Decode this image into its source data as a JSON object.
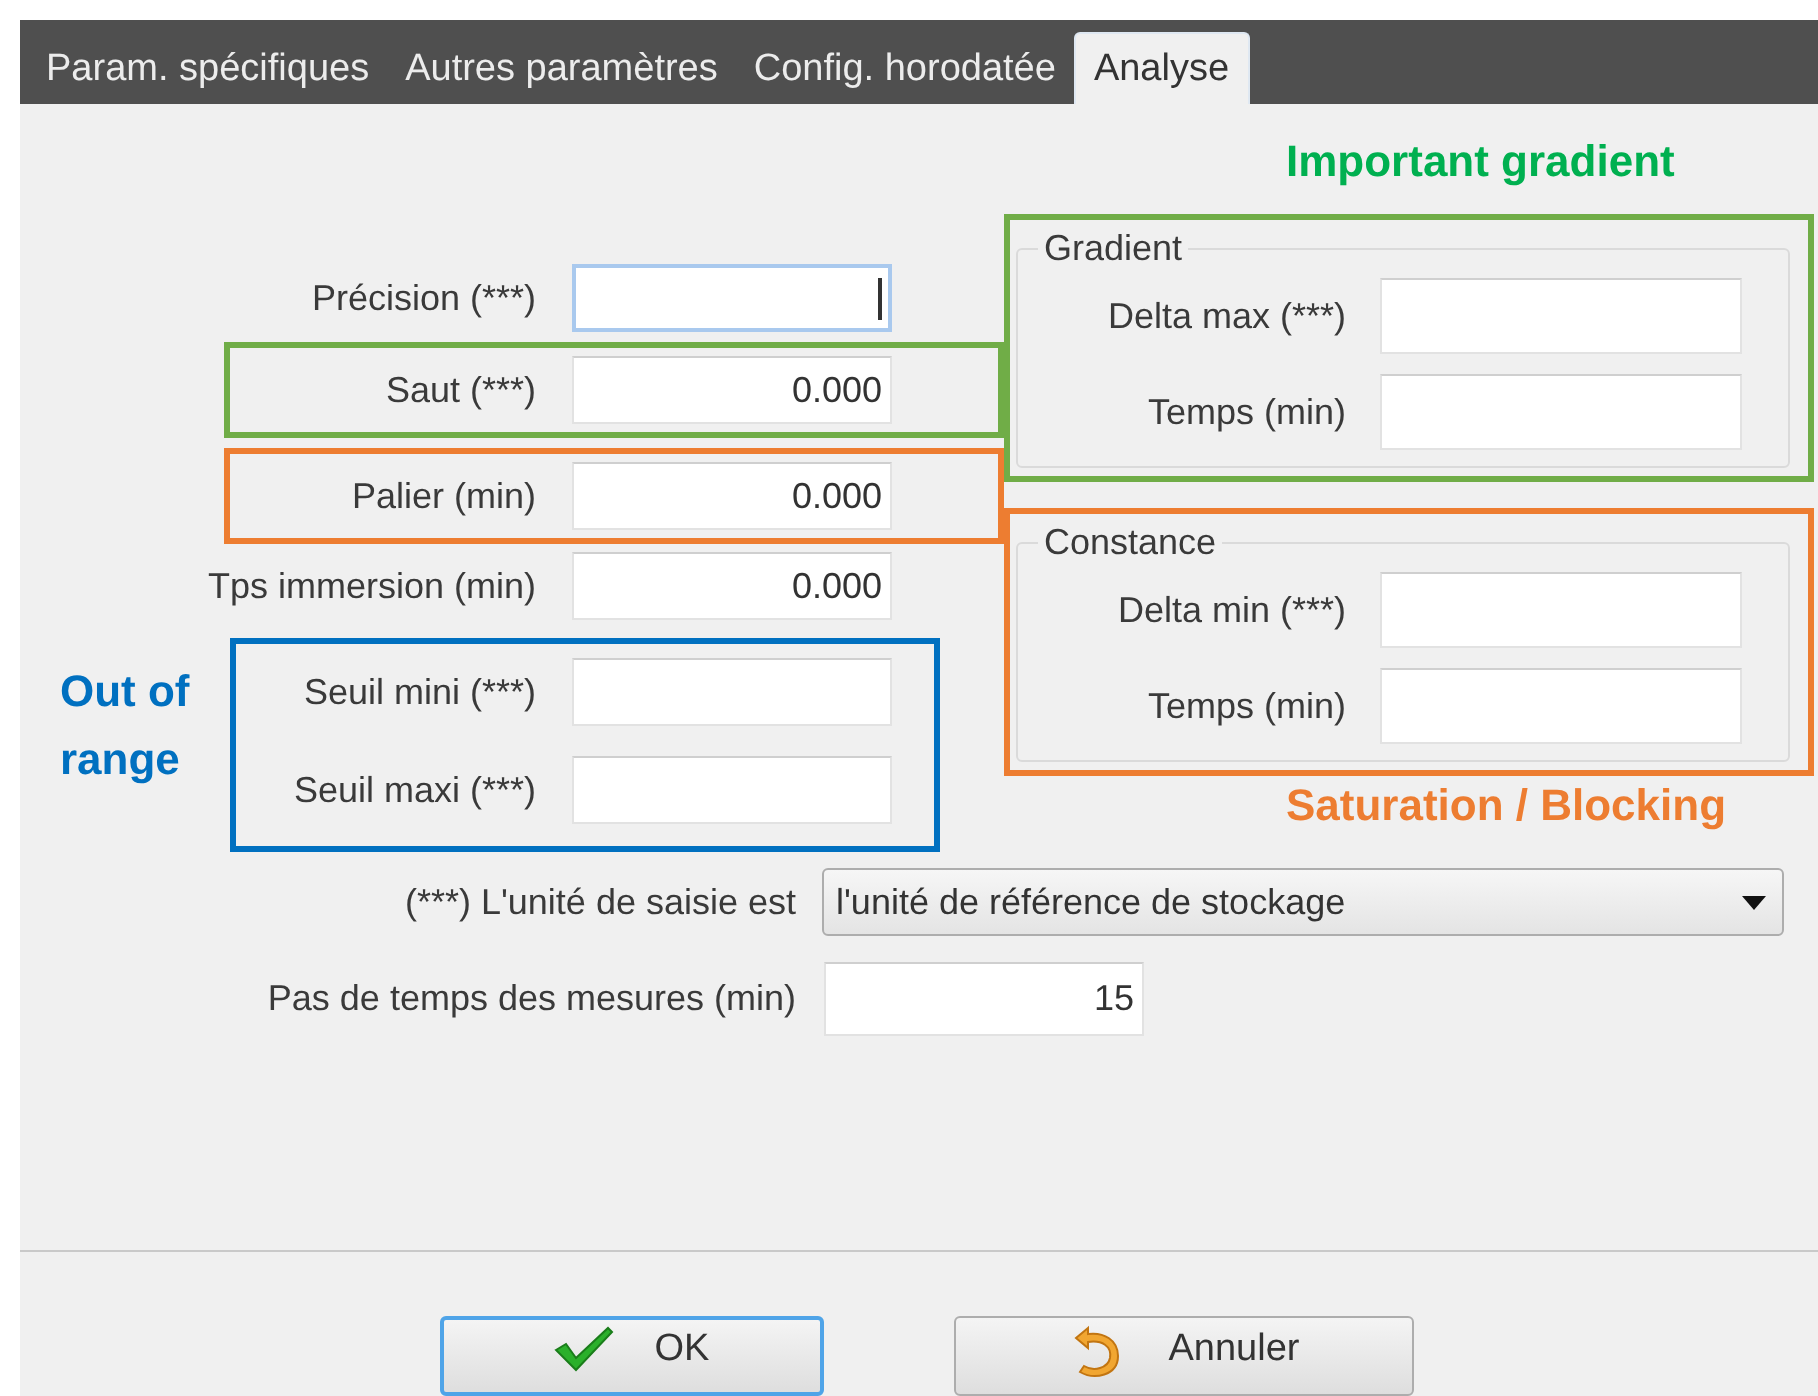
{
  "tabs": [
    {
      "label": "Param. spécifiques",
      "selected": false
    },
    {
      "label": "Autres paramètres",
      "selected": false
    },
    {
      "label": "Config. horodatée",
      "selected": false
    },
    {
      "label": "Analyse",
      "selected": true
    }
  ],
  "left_fields": [
    {
      "kind": "field",
      "label": "Précision (***)",
      "focused": true
    },
    {
      "kind": "frame",
      "color": "#70ad47",
      "fields": [
        {
          "label": "Saut (***)",
          "value": "0.000",
          "focused": false
        }
      ]
    },
    {
      "kind": "frame",
      "color": "#ed7d31",
      "fields": [
        {
          "label": "Palier (min)",
          "value": "0.000",
          "focused": false
        }
      ]
    },
    {
      "kind": "field",
      "label": "Tps immersion (min)",
      "value": "0.000",
      "focused": false
    },
    {
      "kind": "frame",
      "color": "#0070c0",
      "note": {
        "text": "Out of range",
        "color": "#0070c0",
        "kind": "side"
      },
      "fields": [
        {
          "label": "Seuil mini (***)",
          "focused": false
        },
        {
          "label": "Seuil maxi (***)",
          "focused": false
        }
      ]
    }
  ],
  "groups": [
    {
      "title": "Gradient",
      "color": "#70ad47",
      "note": {
        "text": "Important gradient",
        "color": "#00b050",
        "kind": "above"
      },
      "fields": [
        {
          "label": "Delta max (***)"
        },
        {
          "label": "Temps (min)"
        }
      ]
    },
    {
      "title": "Constance",
      "color": "#ed7d31",
      "note": {
        "text": "Saturation / Blocking",
        "color": "#ed7d31",
        "kind": "below"
      },
      "fields": [
        {
          "label": "Delta min (***)"
        },
        {
          "label": "Temps (min)"
        }
      ]
    }
  ],
  "unit_select": {
    "label": "(***) L'unité de saisie est",
    "value": "l'unité de référence de stockage"
  },
  "time_step": {
    "label": "Pas de temps des mesures (min)",
    "value": "15"
  },
  "buttons": [
    {
      "label": "OK",
      "kind": "ok",
      "focused": true
    },
    {
      "label": "Annuler",
      "kind": "cancel",
      "focused": false
    }
  ]
}
